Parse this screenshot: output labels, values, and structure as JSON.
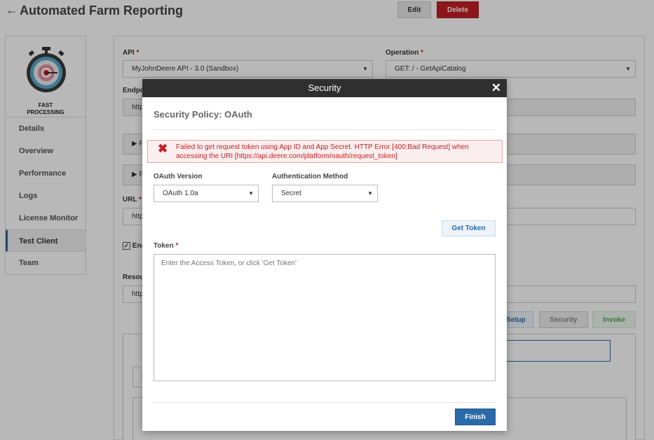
{
  "header": {
    "title": "Automated Farm Reporting",
    "edit_label": "Edit",
    "delete_label": "Delete"
  },
  "sidebar": {
    "logo_caption_line1": "FAST",
    "logo_caption_line2": "PROCESSING",
    "items": [
      {
        "label": "Details"
      },
      {
        "label": "Overview"
      },
      {
        "label": "Performance"
      },
      {
        "label": "Logs"
      },
      {
        "label": "License Monitor"
      },
      {
        "label": "Test Client"
      },
      {
        "label": "Team"
      }
    ]
  },
  "form": {
    "api_label": "API",
    "api_value": "MyJohnDeere API - 3.0 (Sandbox)",
    "operation_label": "Operation",
    "operation_value": "GET: / - GetApiCatalog",
    "endpoint_label_partial": "Endpoi",
    "endpoint_value_partial": "http",
    "url_label": "URL",
    "url_value_partial": "http",
    "enable_label_partial": "Ena",
    "resource_label_partial": "Resou",
    "resource_value_partial": "http",
    "collapse1_partial": "▶ F",
    "collapse2_partial": "▶ F",
    "inner_tab_partial": "F",
    "setup_label": "Setup",
    "security_label": "Security",
    "invoke_label": "Invoke"
  },
  "modal": {
    "title": "Security",
    "policy_title": "Security Policy: OAuth",
    "error_text": "Failed to get request token using App ID and App Secret. HTTP Error [400:Bad Request] when accessing the URI [https://api.deere.com/platform/oauth/request_token]",
    "oauth_version_label": "OAuth Version",
    "oauth_version_value": "OAuth 1.0a",
    "auth_method_label": "Authentication Method",
    "auth_method_value": "Secret",
    "get_token_label": "Get Token",
    "token_label": "Token",
    "token_placeholder": "Enter the Access Token, or click 'Get Token'",
    "finish_label": "Finish"
  },
  "colors": {
    "accent": "#2a6aa8",
    "danger": "#c41f26"
  }
}
